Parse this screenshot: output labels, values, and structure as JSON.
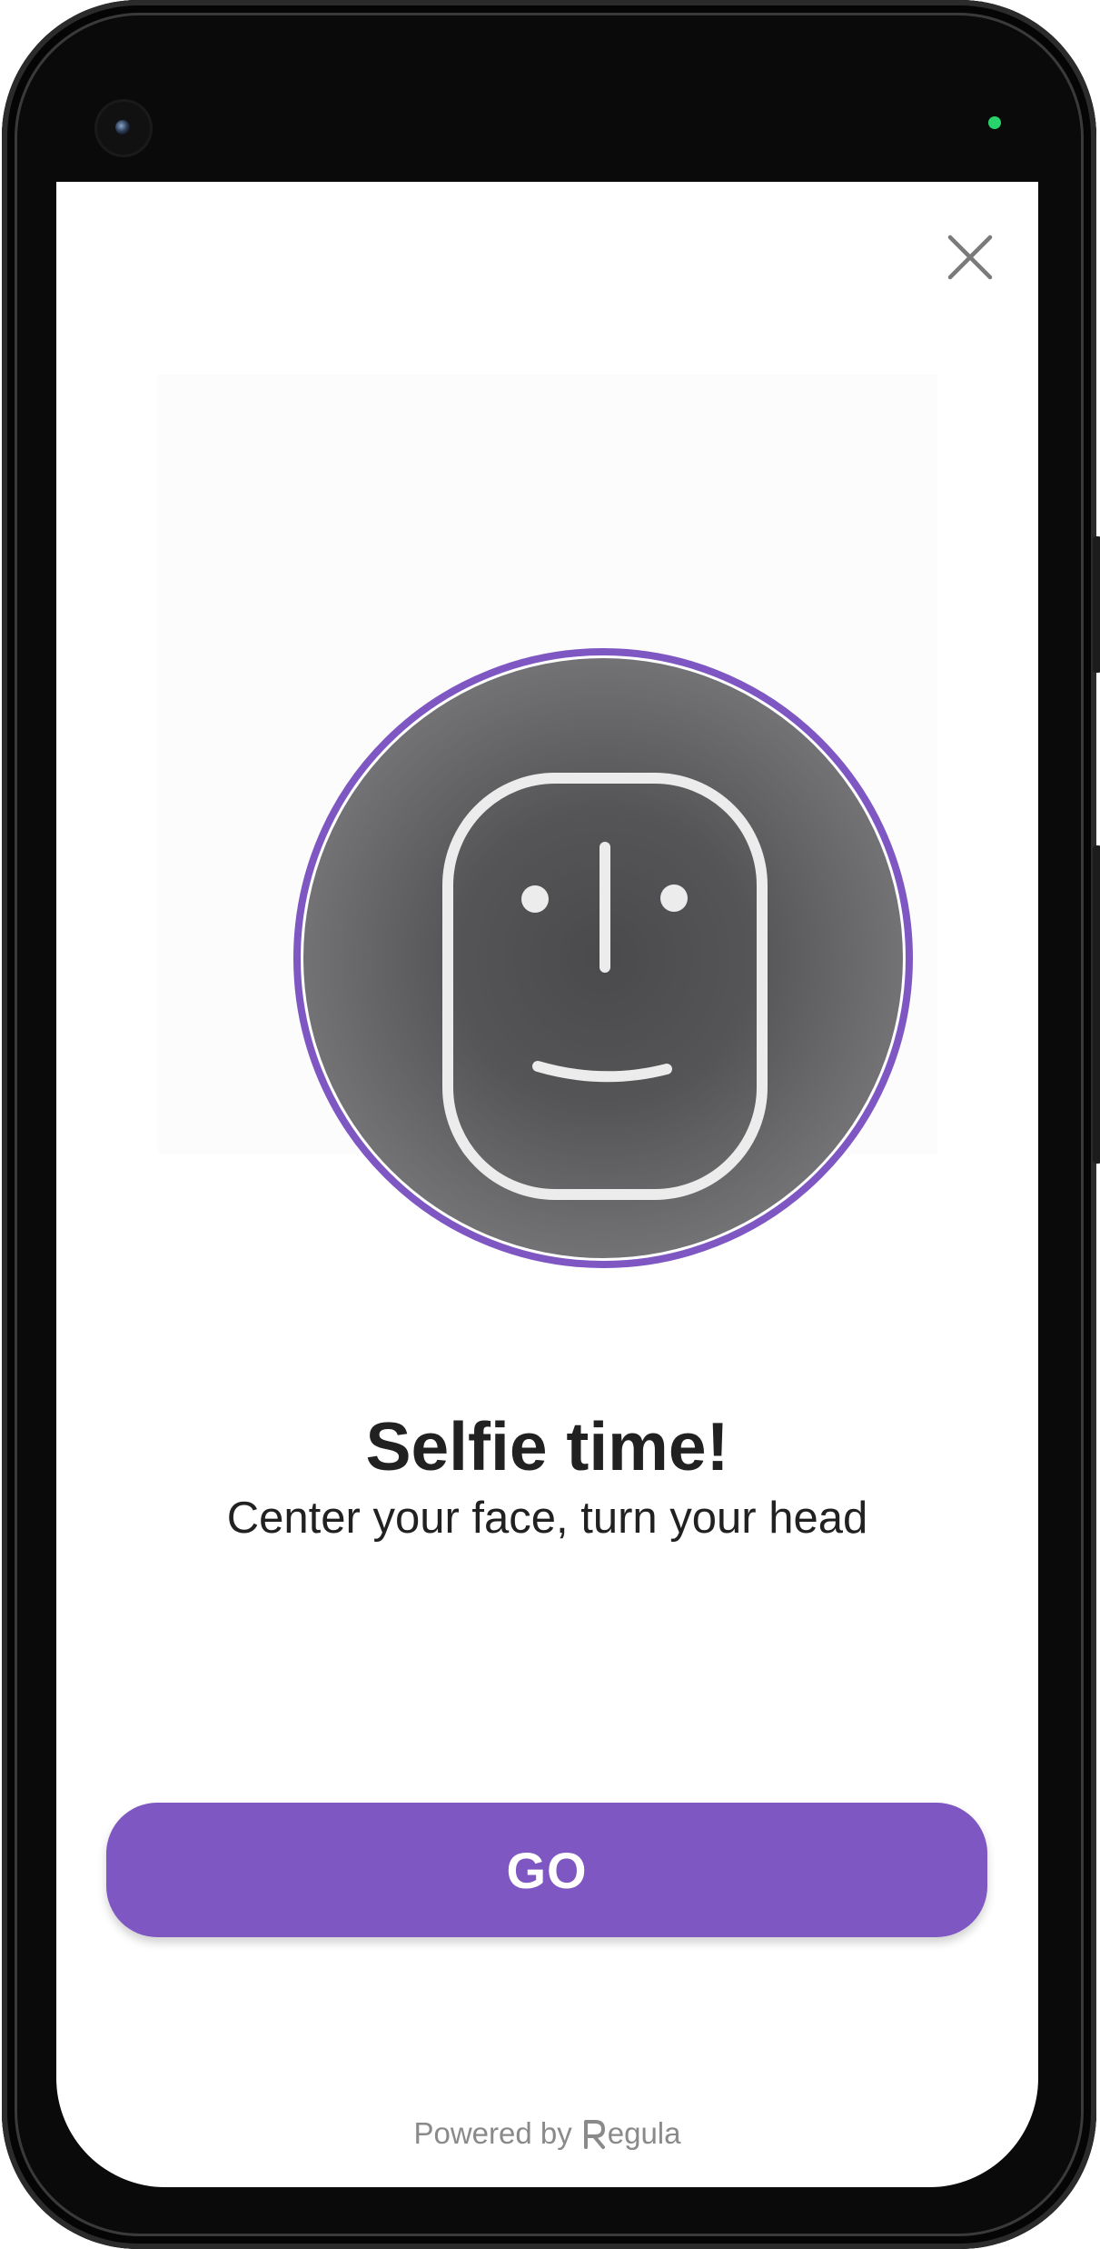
{
  "screen": {
    "close_icon": "close-icon",
    "illustration_icon": "face-icon",
    "title": "Selfie time!",
    "subtitle": "Center your face, turn your head",
    "go_label": "GO",
    "powered_by": "Powered by",
    "brand_name": "egula",
    "brand_logo_icon": "regula-logo-icon"
  },
  "colors": {
    "accent": "#7e57c2",
    "text": "#212121",
    "muted": "#8a8a8a",
    "disc": "#5a5a5c"
  }
}
